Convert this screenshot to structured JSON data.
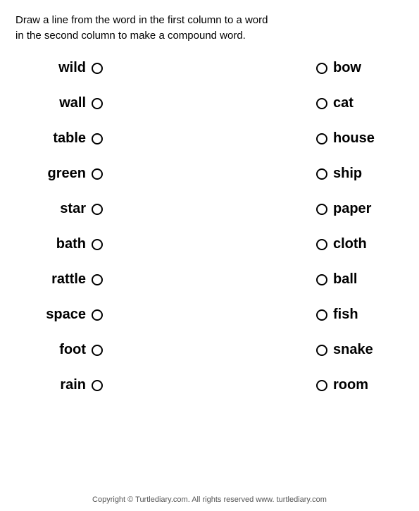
{
  "instruction": {
    "line1": "Draw a line from the word in the first column to a word",
    "line2": "in the second column to make a compound word."
  },
  "left_column": [
    {
      "word": "wild"
    },
    {
      "word": "wall"
    },
    {
      "word": "table"
    },
    {
      "word": "green"
    },
    {
      "word": "star"
    },
    {
      "word": "bath"
    },
    {
      "word": "rattle"
    },
    {
      "word": "space"
    },
    {
      "word": "foot"
    },
    {
      "word": "rain"
    }
  ],
  "right_column": [
    {
      "word": "bow"
    },
    {
      "word": "cat"
    },
    {
      "word": "house"
    },
    {
      "word": "ship"
    },
    {
      "word": "paper"
    },
    {
      "word": "cloth"
    },
    {
      "word": "ball"
    },
    {
      "word": "fish"
    },
    {
      "word": "snake"
    },
    {
      "word": "room"
    }
  ],
  "footer": {
    "text": "Copyright © Turtlediary.com. All rights reserved   www. turtlediary.com"
  }
}
